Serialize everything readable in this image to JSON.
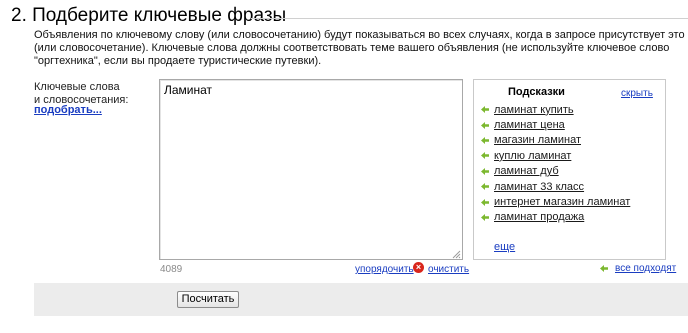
{
  "section": {
    "title": "2. Подберите ключевые фразы"
  },
  "description": {
    "line1": "Объявления по ключевому слову (или словосочетанию) будут показываться во всех случаях, когда в запросе присутствует это слово",
    "line2": "(или словосочетание). Ключевые слова должны соответствовать теме вашего объявления (не используйте ключевое слово",
    "line3": "\"оргтехника\", если вы продаете туристические путевки)."
  },
  "keywords": {
    "label_line1": "Ключевые слова",
    "label_line2": "и словосочетания:",
    "pick_link": "подобрать...",
    "value": "Ламинат",
    "counter": "4089",
    "sort_link": "упорядочить",
    "clear_link": "очистить"
  },
  "suggestions": {
    "title": "Подсказки",
    "hide_link": "скрыть",
    "items": [
      "ламинат купить",
      "ламинат цена",
      "магазин ламинат",
      "куплю ламинат",
      "ламинат дуб",
      "ламинат 33 класс",
      "интернет магазин ламинат",
      "ламинат продажа"
    ],
    "more_link": "еще",
    "all_fit_link": "все подходят"
  },
  "footer": {
    "calc_button": "Посчитать"
  },
  "icons": {
    "add_arrow": "arrow-left-icon",
    "clear": "clear-icon"
  },
  "colors": {
    "link": "#1a3dc1",
    "arrow": "#7cb82f",
    "clear_icon": "#d9261c",
    "footer_bg": "#ececec"
  }
}
